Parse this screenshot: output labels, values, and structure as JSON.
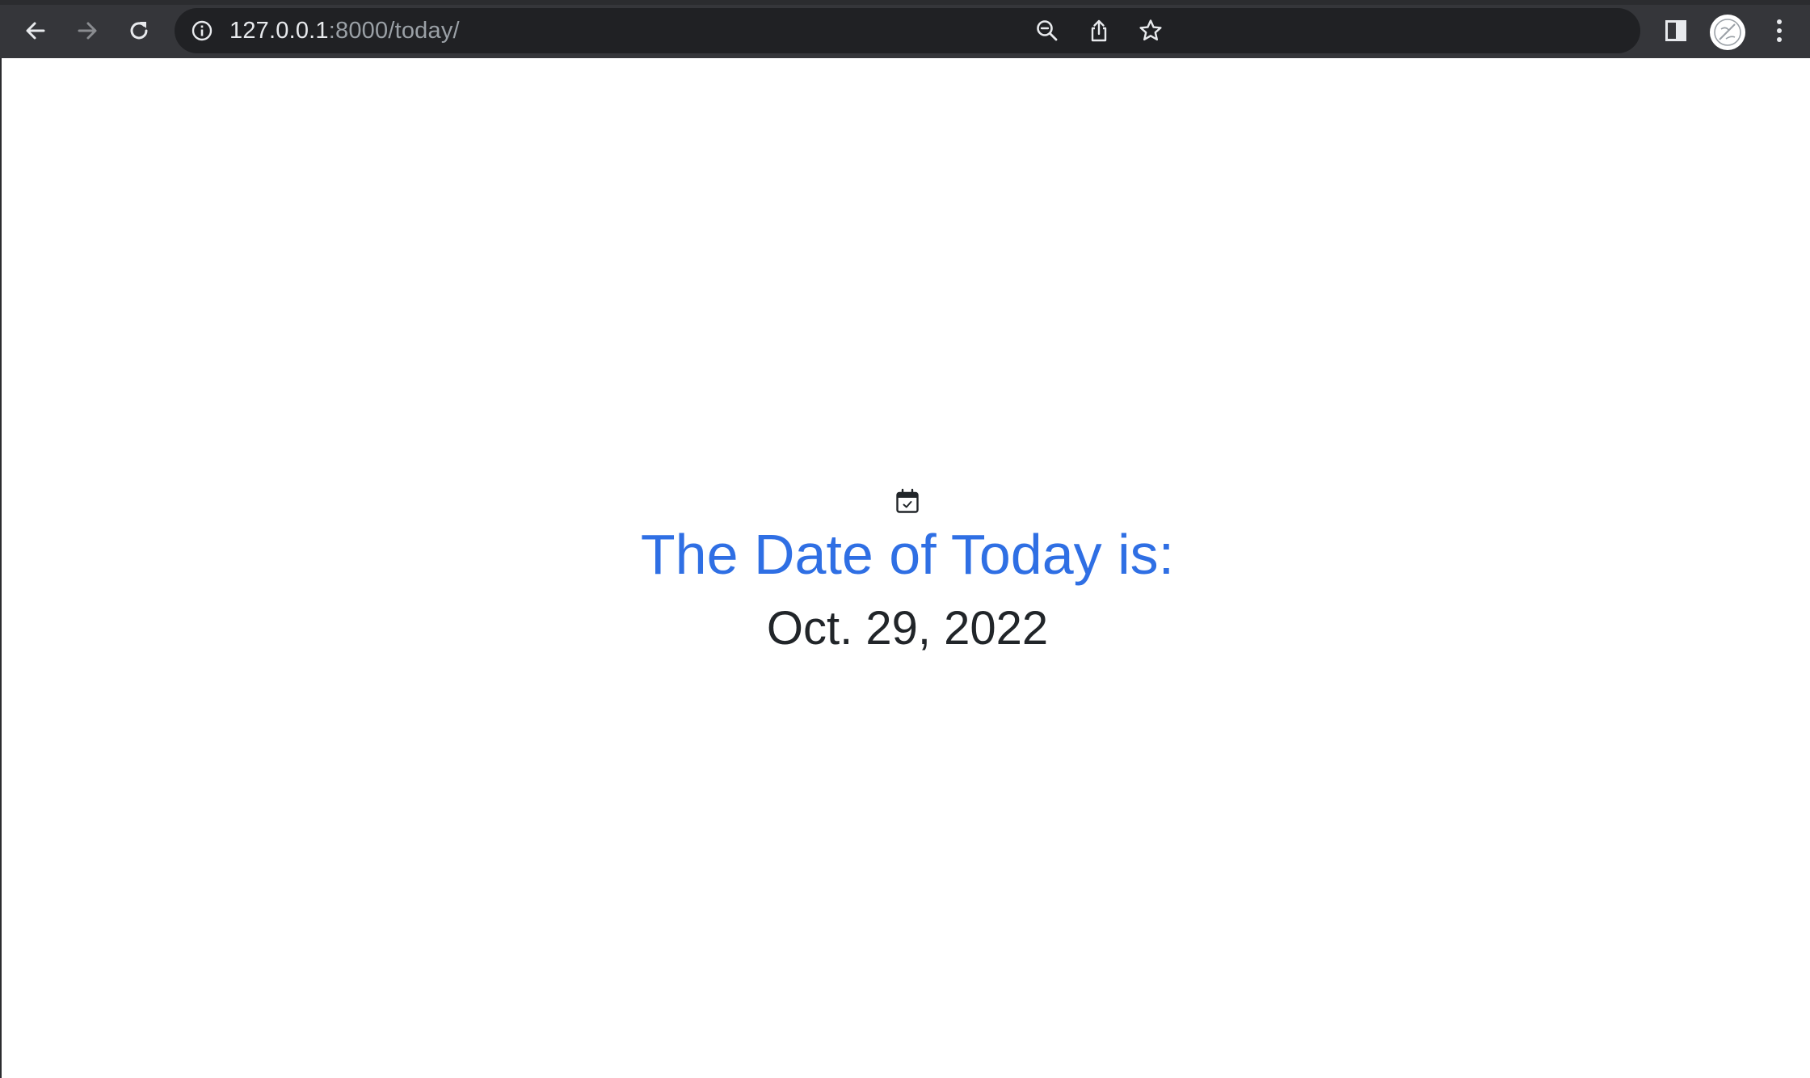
{
  "browser": {
    "url_host": "127.0.0.1",
    "url_rest": ":8000/today/",
    "icons": {
      "back": "back-arrow-icon",
      "forward": "forward-arrow-icon",
      "reload": "reload-icon",
      "site_info": "info-icon",
      "zoom": "zoom-out-icon",
      "share": "share-icon",
      "bookmark": "star-icon",
      "side_panel": "side-panel-icon",
      "profile": "avatar",
      "menu": "kebab-menu-icon"
    },
    "colors": {
      "toolbar": "#35363a",
      "omnibox": "#202124",
      "url_host": "#e8eaed",
      "url_rest": "#9aa0a6"
    }
  },
  "page": {
    "heading": "The Date of Today is:",
    "date": "Oct. 29, 2022",
    "icon": "calendar-check-icon",
    "colors": {
      "heading": "#2f6fe4",
      "date": "#212529"
    }
  }
}
